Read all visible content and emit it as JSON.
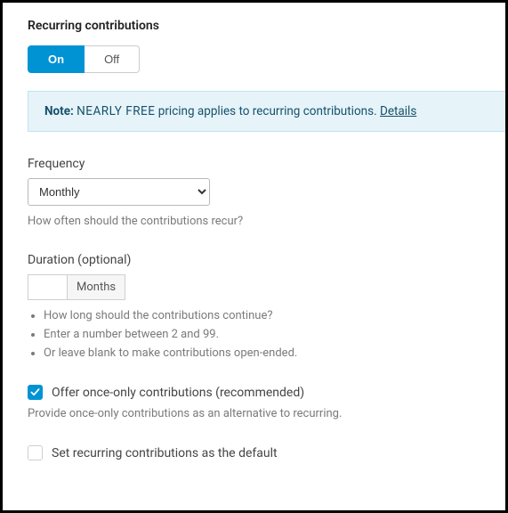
{
  "section": {
    "title": "Recurring contributions"
  },
  "toggle": {
    "on": "On",
    "off": "Off",
    "active": "on"
  },
  "note": {
    "prefix": "Note:",
    "pricing": "NEARLY FREE",
    "body": "pricing applies to recurring contributions.",
    "link": "Details"
  },
  "frequency": {
    "label": "Frequency",
    "value": "Monthly",
    "options": [
      "Monthly"
    ],
    "help": "How often should the contributions recur?"
  },
  "duration": {
    "label": "Duration (optional)",
    "value": "",
    "unit": "Months",
    "bullets": [
      "How long should the contributions continue?",
      "Enter a number between 2 and 99.",
      "Or leave blank to make contributions open-ended."
    ]
  },
  "once_only": {
    "checked": true,
    "label": "Offer once-only contributions (recommended)",
    "help": "Provide once-only contributions as an alternative to recurring."
  },
  "default_recurring": {
    "checked": false,
    "label": "Set recurring contributions as the default"
  }
}
